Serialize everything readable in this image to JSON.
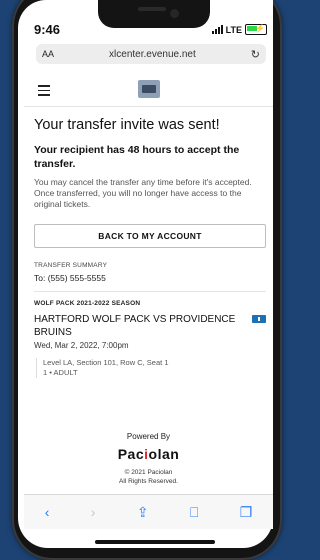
{
  "status": {
    "time": "9:46",
    "carrier": "LTE"
  },
  "browser": {
    "aa_label": "AA",
    "url": "xlcenter.evenue.net",
    "reload_glyph": "↻"
  },
  "page": {
    "title": "Your transfer invite was sent!",
    "subtitle": "Your recipient has 48 hours to accept the transfer.",
    "note": "You may cancel the transfer any time before it's accepted. Once transferred, you will no longer have access to the original tickets.",
    "back_button": "BACK TO MY ACCOUNT",
    "summary_label": "TRANSFER SUMMARY",
    "to_prefix": "To:",
    "to_phone": "(555) 555-5555",
    "season": "WOLF PACK 2021-2022 SEASON",
    "event_name": "HARTFORD WOLF PACK VS PROVIDENCE BRUINS",
    "event_date": "Wed, Mar 2, 2022, 7:00pm",
    "seat_line": "Level LA, Section 101, Row C, Seat 1",
    "ticket_line": "1 • ADULT"
  },
  "footer": {
    "powered_by": "Powered By",
    "brand_part1": "Pac",
    "brand_part2": "i",
    "brand_part3": "olan",
    "copyright_line1": "© 2021 Paciolan",
    "copyright_line2": "All Rights Reserved."
  },
  "toolbar": {
    "back": "‹",
    "forward": "›",
    "share": "⇪",
    "bookmarks": "⎕",
    "tabs": "❐"
  },
  "colors": {
    "accent": "#2b7cf5",
    "brand_red": "#d9272e",
    "ticket_blue": "#1f6fb4",
    "background": "#1d4374"
  }
}
